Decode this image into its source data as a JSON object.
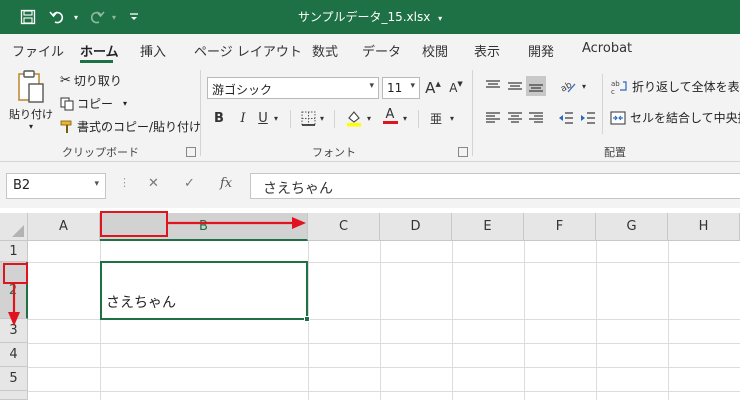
{
  "window": {
    "title": "サンプルデータ_15.xlsx"
  },
  "tabs": [
    {
      "label": "ファイル",
      "active": false
    },
    {
      "label": "ホーム",
      "active": true
    },
    {
      "label": "挿入",
      "active": false
    },
    {
      "label": "ページ レイアウト",
      "active": false
    },
    {
      "label": "数式",
      "active": false
    },
    {
      "label": "データ",
      "active": false
    },
    {
      "label": "校閲",
      "active": false
    },
    {
      "label": "表示",
      "active": false
    },
    {
      "label": "開発",
      "active": false
    },
    {
      "label": "Acrobat",
      "active": false
    }
  ],
  "ribbon": {
    "clipboard": {
      "paste_label": "貼り付け",
      "cut_label": "切り取り",
      "copy_label": "コピー",
      "format_painter_label": "書式のコピー/貼り付け",
      "group_label": "クリップボード"
    },
    "font": {
      "font_name": "游ゴシック",
      "font_size": "11",
      "grow_label": "A",
      "shrink_label": "A",
      "bold_label": "B",
      "italic_label": "I",
      "underline_label": "U",
      "font_color_label": "A",
      "phonetic_label": "亜",
      "group_label": "フォント"
    },
    "alignment": {
      "wrap_text_label": "折り返して全体を表示す",
      "merge_label": "セルを結合して中央揃え",
      "group_label": "配置"
    }
  },
  "formula_bar": {
    "name_box": "B2",
    "fx_label": "fx",
    "formula": "さえちゃん"
  },
  "grid": {
    "columns": [
      "A",
      "B",
      "C",
      "D",
      "E",
      "F",
      "G",
      "H"
    ],
    "rows": [
      "1",
      "2",
      "3",
      "4",
      "5"
    ],
    "selected_column": "B",
    "selected_row": "2",
    "cell_b2": "さえちゃん"
  },
  "colors": {
    "excel_green": "#1e7145",
    "annotation_red": "#e0141e",
    "highlight_yellow": "#ffff00",
    "font_red": "#e0141e"
  }
}
